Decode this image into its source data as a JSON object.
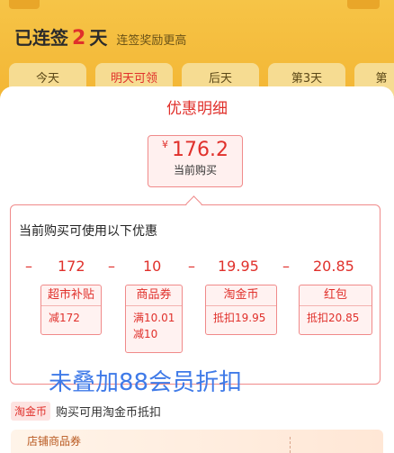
{
  "header": {
    "streak_prefix": "已连签",
    "streak_days": "2",
    "streak_suffix": "天",
    "streak_hint": "连签奖励更高"
  },
  "day_tabs": [
    "今天",
    "明天可领",
    "后天",
    "第3天",
    "第"
  ],
  "sheet": {
    "title": "优惠明细",
    "current": {
      "currency": "¥",
      "price": "176.2",
      "label": "当前购买"
    },
    "detail_heading": "当前购买可使用以下优惠",
    "discounts": [
      {
        "amount": "172",
        "name": "超市补贴",
        "lines": [
          "减172"
        ]
      },
      {
        "amount": "10",
        "name": "商品券",
        "lines": [
          "满10.01",
          "减10"
        ]
      },
      {
        "amount": "19.95",
        "name": "淘金币",
        "lines": [
          "抵扣19.95"
        ]
      },
      {
        "amount": "20.85",
        "name": "红包",
        "lines": [
          "抵扣20.85"
        ]
      }
    ],
    "minus": "–",
    "watermark": "未叠加88会员折扣",
    "taojinbi_badge": "淘金币",
    "taojinbi_text": "购买可用淘金币抵扣",
    "store_label": "店铺商品券"
  },
  "colors": {
    "accent": "#e0302b",
    "background": "#f5b93a",
    "watermark": "#3f7ae8"
  }
}
